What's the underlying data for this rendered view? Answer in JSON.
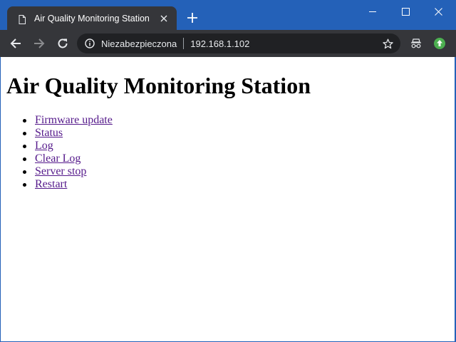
{
  "tab": {
    "title": "Air Quality Monitoring Station"
  },
  "omnibox": {
    "security_label": "Niezabezpieczona",
    "url": "192.168.1.102"
  },
  "page": {
    "heading": "Air Quality Monitoring Station",
    "links": [
      {
        "label": "Firmware update",
        "visited": true
      },
      {
        "label": "Status",
        "visited": true
      },
      {
        "label": "Log",
        "visited": true
      },
      {
        "label": "Clear Log",
        "visited": true
      },
      {
        "label": "Server stop",
        "visited": true
      },
      {
        "label": "Restart",
        "visited": true
      }
    ]
  },
  "colors": {
    "titlebar": "#2461b8",
    "toolbar": "#35363a",
    "omnibox": "#202124",
    "visited_link": "#551a8b",
    "update_badge": "#4caf50"
  },
  "icons": {
    "tab": "page-icon",
    "tab_close": "close-icon",
    "new_tab": "plus-icon",
    "back": "back-arrow-icon",
    "forward": "forward-arrow-icon",
    "reload": "reload-icon",
    "info": "info-icon",
    "bookmark": "star-icon",
    "incognito": "incognito-icon",
    "update": "update-arrow-icon"
  }
}
